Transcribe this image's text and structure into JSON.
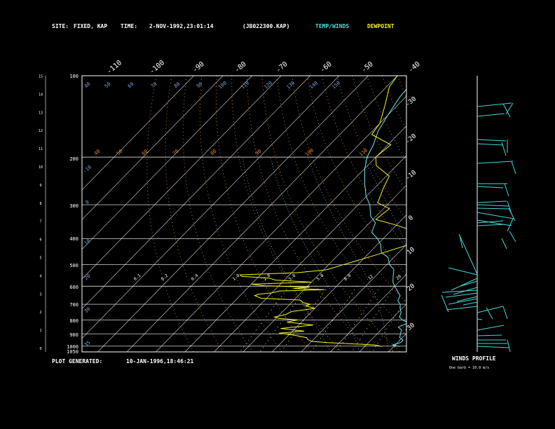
{
  "header": {
    "site_label": "SITE:",
    "site_value": "FIXED, KAP",
    "time_label": "TIME:",
    "time_value": "2-NOV-1992,23:01:14",
    "file_id": "(JB022300.KAP)",
    "temp_winds_label": "TEMP/WINDS",
    "dewpoint_label": "DEWPOINT"
  },
  "footer": {
    "generated_label": "PLOT GENERATED:",
    "generated_value": "10-JAN-1996,18:46:21"
  },
  "winds_panel": {
    "title": "WINDS PROFILE",
    "note": "One barb = 10.0 m/s"
  },
  "colors": {
    "temperature": "#6ee8e8",
    "dewpoint": "#f5f51e",
    "isotherm": "#ffffff",
    "isobar": "#ffffff",
    "dry_adiabat": "#e08a2e",
    "moist_adiabat": "#6fa8dc",
    "mixing_ratio": "#ffffff",
    "winds": "#45d6d6"
  },
  "chart_data": {
    "type": "line",
    "title": "",
    "left_height_ticks": [
      "0",
      "1",
      "2",
      "3",
      "4",
      "5",
      "6",
      "7",
      "8",
      "9",
      "10",
      "11",
      "12",
      "13",
      "14",
      "15"
    ],
    "pressure_labels": [
      "1050",
      "1000",
      "900",
      "800",
      "700",
      "600",
      "500",
      "400",
      "300",
      "200",
      "100"
    ],
    "isotherm_top_labels": [
      "-110",
      "-100",
      "-90",
      "-80",
      "-70",
      "-60",
      "-50",
      "-40"
    ],
    "isotherm_right_labels": [
      "-30",
      "-20",
      "-10",
      "0",
      "10",
      "20",
      "30"
    ],
    "moist_adiabat_labels": [
      "-10",
      "0",
      "10",
      "20",
      "30",
      "35"
    ],
    "top_blue_labels": [
      "40",
      "50",
      "60",
      "70",
      "80",
      "90",
      "100",
      "110",
      "120",
      "130",
      "140",
      "150"
    ],
    "dry_adiabat_labels": [
      "40",
      "50",
      "60",
      "70",
      "80",
      "90",
      "100",
      "110"
    ],
    "mixing_ratio_labels": [
      "0.1",
      "0.2",
      "0.4",
      "1.0",
      "2.0",
      "3.0",
      "5.0",
      "8.0",
      "12",
      "20"
    ],
    "ylim_pressure": [
      1050,
      100
    ],
    "series": [
      {
        "name": "TEMP/WINDS",
        "points": [
          [
            1002,
            12
          ],
          [
            990,
            9
          ],
          [
            970,
            11
          ],
          [
            950,
            11
          ],
          [
            930,
            9
          ],
          [
            900,
            8
          ],
          [
            870,
            7
          ],
          [
            850,
            5
          ],
          [
            820,
            7
          ],
          [
            800,
            4
          ],
          [
            780,
            2
          ],
          [
            750,
            1
          ],
          [
            720,
            -1
          ],
          [
            700,
            -2
          ],
          [
            680,
            -4
          ],
          [
            650,
            -5
          ],
          [
            620,
            -8
          ],
          [
            600,
            -10
          ],
          [
            580,
            -12
          ],
          [
            550,
            -14
          ],
          [
            520,
            -16
          ],
          [
            500,
            -19
          ],
          [
            470,
            -22
          ],
          [
            450,
            -26
          ],
          [
            420,
            -29
          ],
          [
            400,
            -32
          ],
          [
            380,
            -36
          ],
          [
            350,
            -38
          ],
          [
            330,
            -42
          ],
          [
            300,
            -46
          ],
          [
            280,
            -50
          ],
          [
            250,
            -55
          ],
          [
            220,
            -60
          ],
          [
            200,
            -63
          ],
          [
            180,
            -65
          ],
          [
            160,
            -68
          ],
          [
            140,
            -70
          ],
          [
            120,
            -72
          ],
          [
            100,
            -73
          ]
        ]
      },
      {
        "name": "DEWPOINT",
        "points": [
          [
            1002,
            6
          ],
          [
            990,
            3
          ],
          [
            980,
            -6
          ],
          [
            970,
            -14
          ],
          [
            960,
            -20
          ],
          [
            945,
            -22
          ],
          [
            930,
            -23
          ],
          [
            915,
            -27
          ],
          [
            905,
            -30
          ],
          [
            895,
            -34
          ],
          [
            880,
            -26
          ],
          [
            860,
            -35
          ],
          [
            835,
            -25
          ],
          [
            815,
            -35
          ],
          [
            800,
            -32
          ],
          [
            790,
            -39
          ],
          [
            780,
            -41
          ],
          [
            765,
            -38
          ],
          [
            745,
            -37
          ],
          [
            725,
            -30
          ],
          [
            710,
            -34
          ],
          [
            700,
            -33
          ],
          [
            690,
            -36
          ],
          [
            675,
            -38
          ],
          [
            665,
            -52
          ],
          [
            650,
            -55
          ],
          [
            642,
            -54
          ],
          [
            635,
            -50
          ],
          [
            625,
            -48
          ],
          [
            618,
            -33
          ],
          [
            612,
            -44
          ],
          [
            605,
            -39
          ],
          [
            598,
            -55
          ],
          [
            590,
            -60
          ],
          [
            580,
            -40
          ],
          [
            570,
            -53
          ],
          [
            560,
            -56
          ],
          [
            552,
            -66
          ],
          [
            545,
            -67
          ],
          [
            535,
            -48
          ],
          [
            522,
            -39
          ],
          [
            500,
            -35
          ],
          [
            470,
            -29
          ],
          [
            445,
            -24
          ],
          [
            420,
            -19
          ],
          [
            405,
            -21
          ],
          [
            395,
            -22
          ],
          [
            375,
            -22
          ],
          [
            355,
            -31
          ],
          [
            340,
            -39
          ],
          [
            310,
            -38
          ],
          [
            295,
            -44
          ],
          [
            260,
            -47
          ],
          [
            235,
            -49
          ],
          [
            215,
            -57
          ],
          [
            200,
            -60
          ],
          [
            180,
            -59
          ],
          [
            165,
            -69
          ],
          [
            150,
            -70
          ],
          [
            130,
            -74
          ],
          [
            110,
            -79
          ],
          [
            100,
            -80
          ]
        ]
      }
    ],
    "wind_barb_pressures": [
      100,
      120,
      145,
      175,
      205,
      245,
      275,
      305,
      330,
      360,
      380,
      400,
      430,
      460,
      490,
      520,
      555,
      600,
      650,
      700,
      750,
      800,
      850,
      900,
      950,
      1000
    ]
  }
}
